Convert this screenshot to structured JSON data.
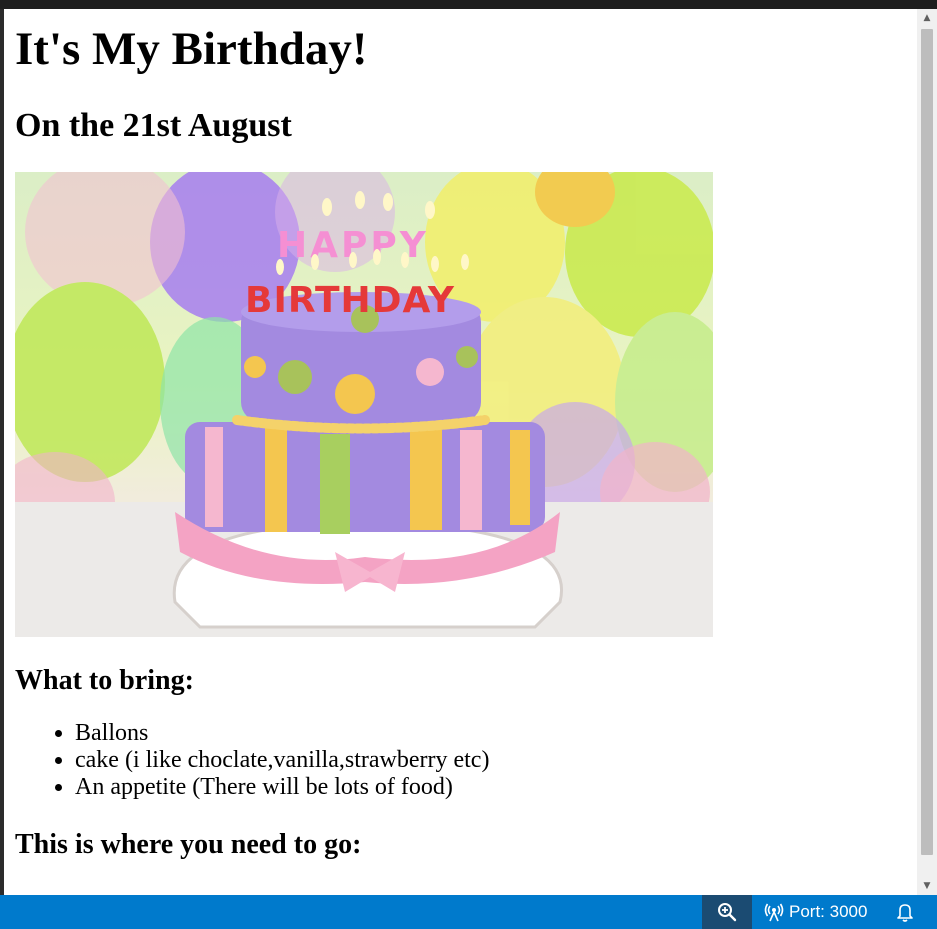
{
  "page": {
    "title": "It's My Birthday!",
    "date_line": "On the 21st August",
    "bring_heading": "What to bring:",
    "bring_items": [
      "Ballons",
      "cake (i like choclate,vanilla,strawberry etc)",
      "An appetite (There will be lots of food)"
    ],
    "location_heading": "This is where you need to go:"
  },
  "image": {
    "cake_candles_text": "HAPPY BIRTHDAY"
  },
  "statusbar": {
    "port_label": "Port: 3000",
    "zoom_icon": "zoom-in-icon",
    "broadcast_icon": "broadcast-icon",
    "bell_icon": "bell-icon",
    "background_color": "#007acc"
  }
}
